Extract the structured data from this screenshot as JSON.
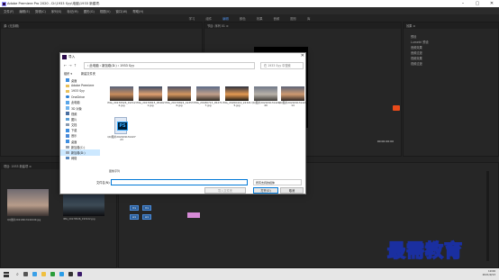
{
  "app": {
    "title": "Adobe Premiere Pro 2020 - D:\\1933 Syy\\电脑\\1933 新建项.",
    "menu": [
      "文件(F)",
      "编辑(E)",
      "剪辑(C)",
      "序列(S)",
      "标记(M)",
      "图形(G)",
      "视图(V)",
      "窗口(W)",
      "帮助(H)"
    ],
    "workspaces": [
      "学习",
      "组件",
      "编辑",
      "颜色",
      "效果",
      "音频",
      "图形",
      "库"
    ],
    "active_workspace": "编辑"
  },
  "dialog": {
    "title": "导入",
    "address_path": "› 此电脑 › 新加卷(D:) › 1933 Syy",
    "search_placeholder": "在 1933 Syy 中搜索",
    "organize_label": "组织 ▾",
    "new_folder_label": "新建文件夹",
    "nav_items": [
      "桌面",
      "Adobe Premiere",
      "1933 Syy",
      "OneDrive",
      "此电脑",
      "3D 对象",
      "视频",
      "图片",
      "文档",
      "下载",
      "音乐",
      "桌面",
      "新加卷(C:)",
      "新加卷(D:)",
      "网络"
    ],
    "selected_nav": "新加卷(D:)",
    "files": [
      {
        "name": "IMG_20170526_193122.jpg",
        "tone": "sunset1"
      },
      {
        "name": "IMG_20170815_054621.jpg",
        "tone": "sunset2"
      },
      {
        "name": "IMG_20170824_193536.jpg",
        "tone": "sunset3"
      },
      {
        "name": "IMG_20180715_052717.jpg",
        "tone": "sunset4"
      },
      {
        "name": "IMG_20200419_223215.jpg",
        "tone": "sunset5"
      },
      {
        "name": "QQ图片20210913142449",
        "tone": "sunset6"
      },
      {
        "name": "QQ图片20210913142714",
        "tone": "sunset7"
      }
    ],
    "psd_file": {
      "name": "QQ图片20210913142723",
      "badge": "PS"
    },
    "import_option": "图像序列",
    "filename_label": "文件名(N):",
    "filename_value": "",
    "filetype_value": "所有支持的媒体",
    "open_label": "打开(O)",
    "cancel_label": "取消",
    "ghost_label": "导入文件夹"
  },
  "panels": {
    "source_header": "源: (无剪辑)",
    "project_header": "项目: 1933 新建项 ≡",
    "program_header": "节目: 序列 01 ≡",
    "effects_header": "效果 ≡",
    "effects_items": [
      "预设",
      "Lumetri 预设",
      "音频效果",
      "音频过渡",
      "视频效果",
      "视频过渡"
    ],
    "project_clips": [
      "QQ图片20210913142449.jpg",
      "IMG_20170526_193122.jpg"
    ],
    "timecode": "00:00:00:00"
  },
  "taskbar": {
    "time": "19:06",
    "date": "2021/9/13"
  },
  "watermark": "最需教育"
}
